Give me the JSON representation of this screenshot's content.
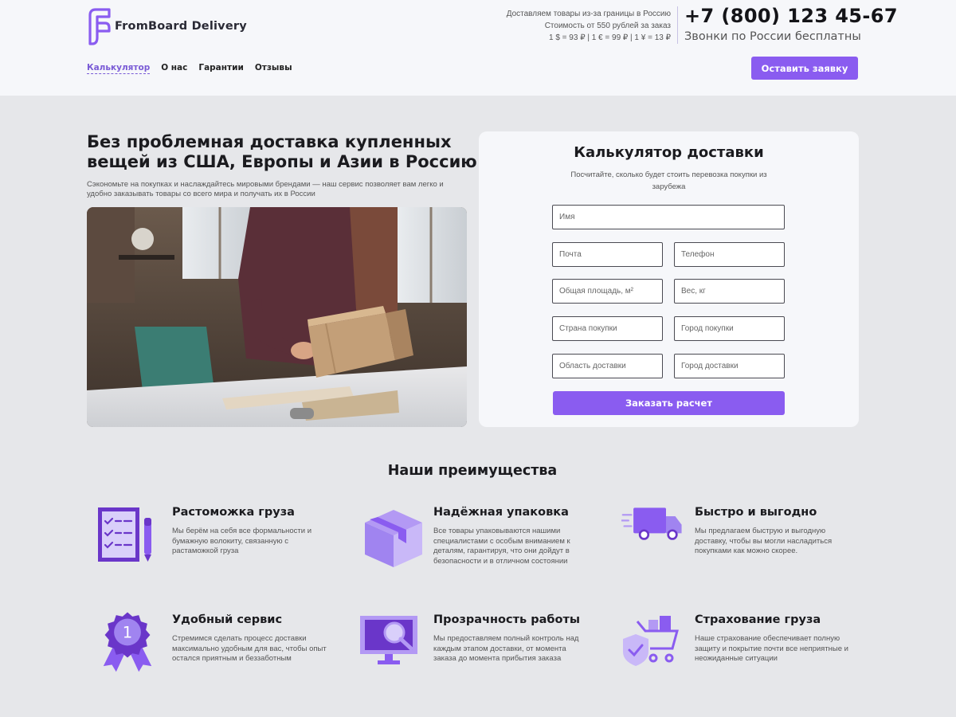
{
  "brand": {
    "name": "FromBoard Delivery",
    "accent": "#8a5cf0"
  },
  "header_info": {
    "line1": "Доставляем товары из-за границы в Россию",
    "line2": "Стоимость от 550 рублей за заказ",
    "line3": "1 $ = 93 ₽ | 1 € = 99 ₽ | 1 ¥ = 13 ₽"
  },
  "contact": {
    "phone": "+7 (800) 123 45-67",
    "note": "Звонки по России бесплатны"
  },
  "nav": {
    "items": [
      {
        "label": "Калькулятор",
        "active": true
      },
      {
        "label": "О нас"
      },
      {
        "label": "Гарантии"
      },
      {
        "label": "Отзывы"
      }
    ],
    "cta": "Оставить заявку"
  },
  "hero": {
    "title": "Без проблемная доставка купленных вещей из США, Европы и Азии в Россию",
    "subtitle": "Сэкономьте на покупках и наслаждайтесь мировыми брендами — наш сервис позволяет вам легко и удобно заказывать товары со всего мира и получать их в России"
  },
  "calculator": {
    "title": "Калькулятор доставки",
    "subtitle": "Посчитайте, сколько будет стоить перевозка покупки из зарубежа",
    "fields": {
      "name": "Имя",
      "email": "Почта",
      "phone": "Телефон",
      "area": "Общая площадь, м²",
      "weight": "Вес, кг",
      "country": "Страна покупки",
      "city_from": "Город покупки",
      "region_to": "Область доставки",
      "city_to": "Город доставки"
    },
    "submit": "Заказать расчет"
  },
  "advantages": {
    "heading": "Наши преимущества",
    "items": [
      {
        "icon": "checklist-icon",
        "title": "Растоможка груза",
        "text": "Мы берём на себя все формальности и бумажную волокиту, связанную с растаможкой груза"
      },
      {
        "icon": "box-icon",
        "title": "Надёжная упаковка",
        "text": "Все товары упаковываются нашими специалистами с особым вниманием к деталям, гарантируя, что они дойдут в безопасности и в отличном состоянии"
      },
      {
        "icon": "truck-icon",
        "title": "Быстро и выгодно",
        "text": "Мы предлагаем быструю и выгодную доставку, чтобы вы могли насладиться покупками как можно скорее."
      },
      {
        "icon": "medal-icon",
        "title": "Удобный сервис",
        "text": "Стремимся сделать процесс доставки максимально удобным для вас, чтобы опыт остался приятным и беззаботным"
      },
      {
        "icon": "monitor-search-icon",
        "title": "Прозрачность работы",
        "text": "Мы предоставляем полный контроль над каждым этапом доставки, от момента заказа до момента прибытия заказа"
      },
      {
        "icon": "shield-cart-icon",
        "title": "Страхование груза",
        "text": "Наше страхование обеспечивает полную защиту и покрытие почти все неприятные и неожиданные ситуации"
      }
    ]
  }
}
